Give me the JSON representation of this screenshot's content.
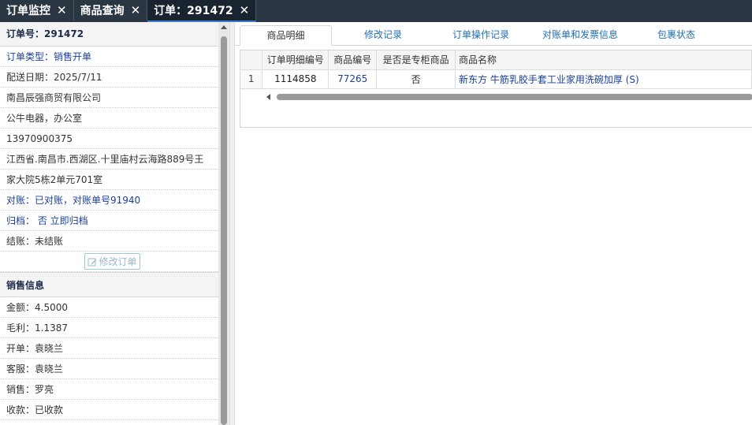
{
  "top_tabs": [
    {
      "label": "订单监控"
    },
    {
      "label": "商品查询"
    },
    {
      "label": "订单：291472"
    }
  ],
  "order": {
    "header": "订单号：291472",
    "type": "订单类型：销售开单",
    "delivery_date": "配送日期：2025/7/11",
    "company": "南昌辰强商贸有限公司",
    "category": "公牛电器，办公室",
    "phone": "13970900375",
    "address_line1": "江西省.南昌市.西湖区.十里庙村云海路889号王",
    "address_line2": "家大院5栋2单元701室",
    "reconcile": "对账：已对账，对账单号91940",
    "archive": "归档：  否 立即归档",
    "settle": "结账：未结账",
    "edit_button": "修改订单"
  },
  "sales": {
    "title": "销售信息",
    "amount": "金额：4.5000",
    "profit": "毛利：1.1387",
    "creator": "开单：袁晓兰",
    "service": "客服：袁晓兰",
    "salesman": "销售：罗亮",
    "payment": "收款：已收款"
  },
  "sub_tabs": [
    {
      "label": "商品明细",
      "active": true
    },
    {
      "label": "修改记录"
    },
    {
      "label": "订单操作记录"
    },
    {
      "label": "对账单和发票信息"
    },
    {
      "label": "包裹状态"
    }
  ],
  "table": {
    "columns": [
      "订单明细编号",
      "商品编号",
      "是否是专柜商品",
      "商品名称"
    ],
    "rows": [
      {
        "row_no": "1",
        "detail_id": "1114858",
        "product_id": "77265",
        "is_counter": "否",
        "name": "新东方 牛筋乳胶手套工业家用洗碗加厚 (S)"
      }
    ]
  },
  "colors": {
    "topbar": "#2b3643",
    "link": "#1a3fa0",
    "tab_link": "#1f6fb2"
  }
}
